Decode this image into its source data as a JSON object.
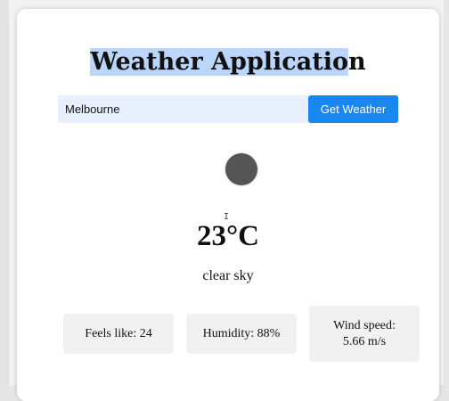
{
  "app": {
    "title_selected": "Weather Applicatio",
    "title_rest": "n"
  },
  "search": {
    "city_value": "Melbourne",
    "button_label": "Get Weather"
  },
  "weather": {
    "temperature": "23°C",
    "description": "clear sky"
  },
  "stats": {
    "feels_like": "Feels like: 24",
    "humidity": "Humidity: 88%",
    "wind_label": "Wind speed:",
    "wind_value": "5.66 m/s"
  },
  "colors": {
    "button": "#1a86f0",
    "input_bg": "#e8f0fe",
    "selection": "#bcd6fb",
    "stat_bg": "#f1f1f1",
    "icon": "#555555"
  }
}
